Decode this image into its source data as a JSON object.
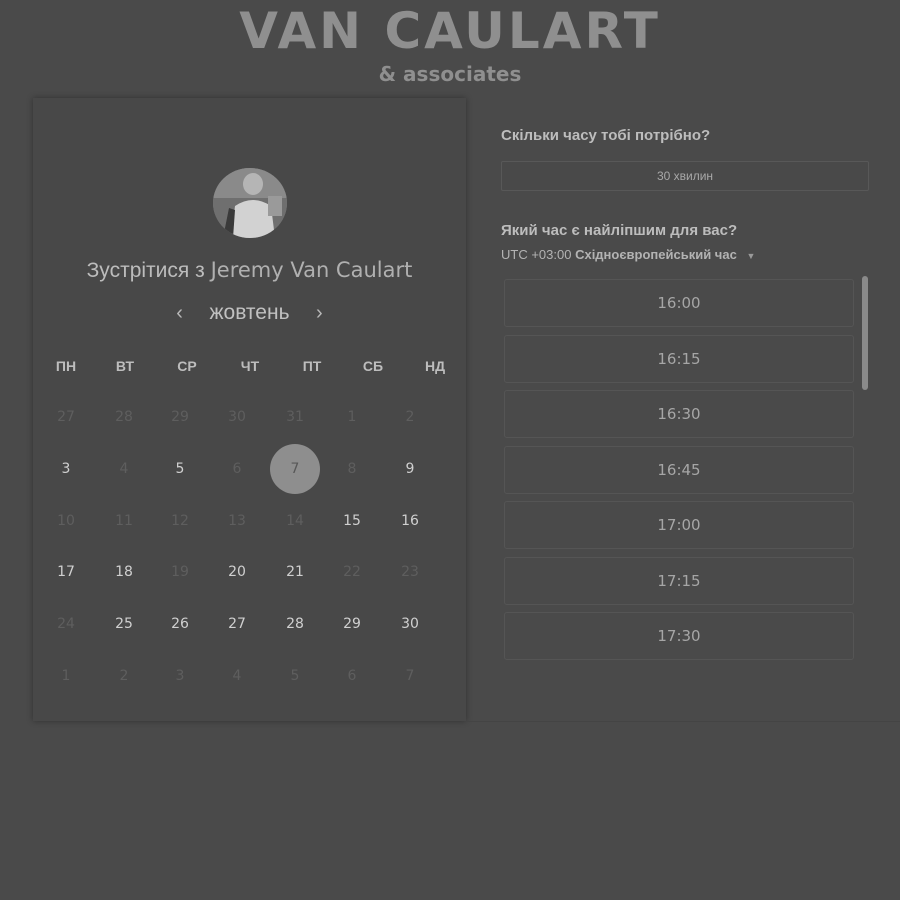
{
  "brand": {
    "title": "VAN CAULART",
    "subtitle": "& associates"
  },
  "booking": {
    "meet_prefix": "Зустрітися з",
    "host_name": "Jeremy Van Caulart",
    "month": "жовтень",
    "prev_icon": "chevron-left-icon",
    "next_icon": "chevron-right-icon"
  },
  "calendar": {
    "weekdays": [
      "ПН",
      "ВТ",
      "СР",
      "ЧТ",
      "ПТ",
      "СБ",
      "НД"
    ],
    "selected_day": "7",
    "weeks": [
      [
        {
          "d": "27",
          "s": "muted"
        },
        {
          "d": "28",
          "s": "muted"
        },
        {
          "d": "29",
          "s": "muted"
        },
        {
          "d": "30",
          "s": "muted"
        },
        {
          "d": "31",
          "s": "muted"
        },
        {
          "d": "1",
          "s": "muted"
        },
        {
          "d": "2",
          "s": "muted"
        }
      ],
      [
        {
          "d": "3",
          "s": "active"
        },
        {
          "d": "4",
          "s": "muted"
        },
        {
          "d": "5",
          "s": "active"
        },
        {
          "d": "6",
          "s": "muted"
        },
        {
          "d": "7",
          "s": "selected"
        },
        {
          "d": "8",
          "s": "muted"
        },
        {
          "d": "9",
          "s": "active"
        }
      ],
      [
        {
          "d": "10",
          "s": "muted"
        },
        {
          "d": "11",
          "s": "muted"
        },
        {
          "d": "12",
          "s": "muted"
        },
        {
          "d": "13",
          "s": "muted"
        },
        {
          "d": "14",
          "s": "muted"
        },
        {
          "d": "15",
          "s": "active"
        },
        {
          "d": "16",
          "s": "active"
        }
      ],
      [
        {
          "d": "17",
          "s": "active"
        },
        {
          "d": "18",
          "s": "active"
        },
        {
          "d": "19",
          "s": "muted"
        },
        {
          "d": "20",
          "s": "active"
        },
        {
          "d": "21",
          "s": "active"
        },
        {
          "d": "22",
          "s": "muted"
        },
        {
          "d": "23",
          "s": "muted"
        }
      ],
      [
        {
          "d": "24",
          "s": "muted"
        },
        {
          "d": "25",
          "s": "active"
        },
        {
          "d": "26",
          "s": "active"
        },
        {
          "d": "27",
          "s": "active"
        },
        {
          "d": "28",
          "s": "active"
        },
        {
          "d": "29",
          "s": "active"
        },
        {
          "d": "30",
          "s": "active"
        }
      ],
      [
        {
          "d": "1",
          "s": "muted"
        },
        {
          "d": "2",
          "s": "muted"
        },
        {
          "d": "3",
          "s": "muted"
        },
        {
          "d": "4",
          "s": "muted"
        },
        {
          "d": "5",
          "s": "muted"
        },
        {
          "d": "6",
          "s": "muted"
        },
        {
          "d": "7",
          "s": "muted"
        }
      ]
    ]
  },
  "scheduler": {
    "duration_question": "Скільки часу тобі потрібно?",
    "duration_value": "30 хвилин",
    "time_question": "Який час є найліпшим для вас?",
    "tz_offset": "UTC +03:00",
    "tz_name": "Східноєвропейський час",
    "tz_caret_icon": "caret-down-icon",
    "slots": [
      "16:00",
      "16:15",
      "16:30",
      "16:45",
      "17:00",
      "17:15",
      "17:30"
    ]
  }
}
